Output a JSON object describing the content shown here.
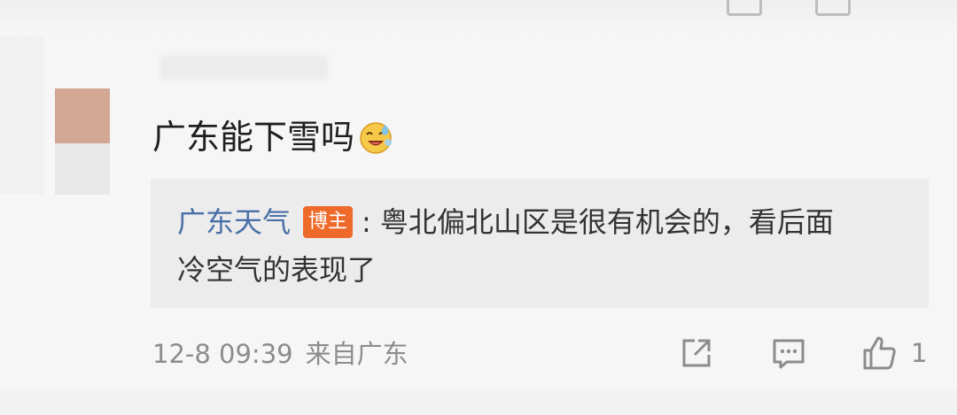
{
  "comment": {
    "text": "广东能下雪吗",
    "emoji": "laughing-sweat-emoji"
  },
  "reply": {
    "author": "广东天气",
    "badge": "博主",
    "separator": ":",
    "line1": "粤北偏北山区是很有机会的，看后面",
    "line2": "冷空气的表现了"
  },
  "footer": {
    "time": "12-8 09:39",
    "source": "来自广东",
    "like_count": "1"
  },
  "icons": {
    "share": "share-icon",
    "comment": "comment-icon",
    "like": "thumbs-up-icon"
  },
  "colors": {
    "author_link": "#4a6fa8",
    "badge_bg": "#ee6a2a",
    "meta_text": "#8c8c8c",
    "reply_bg": "#ececec"
  }
}
